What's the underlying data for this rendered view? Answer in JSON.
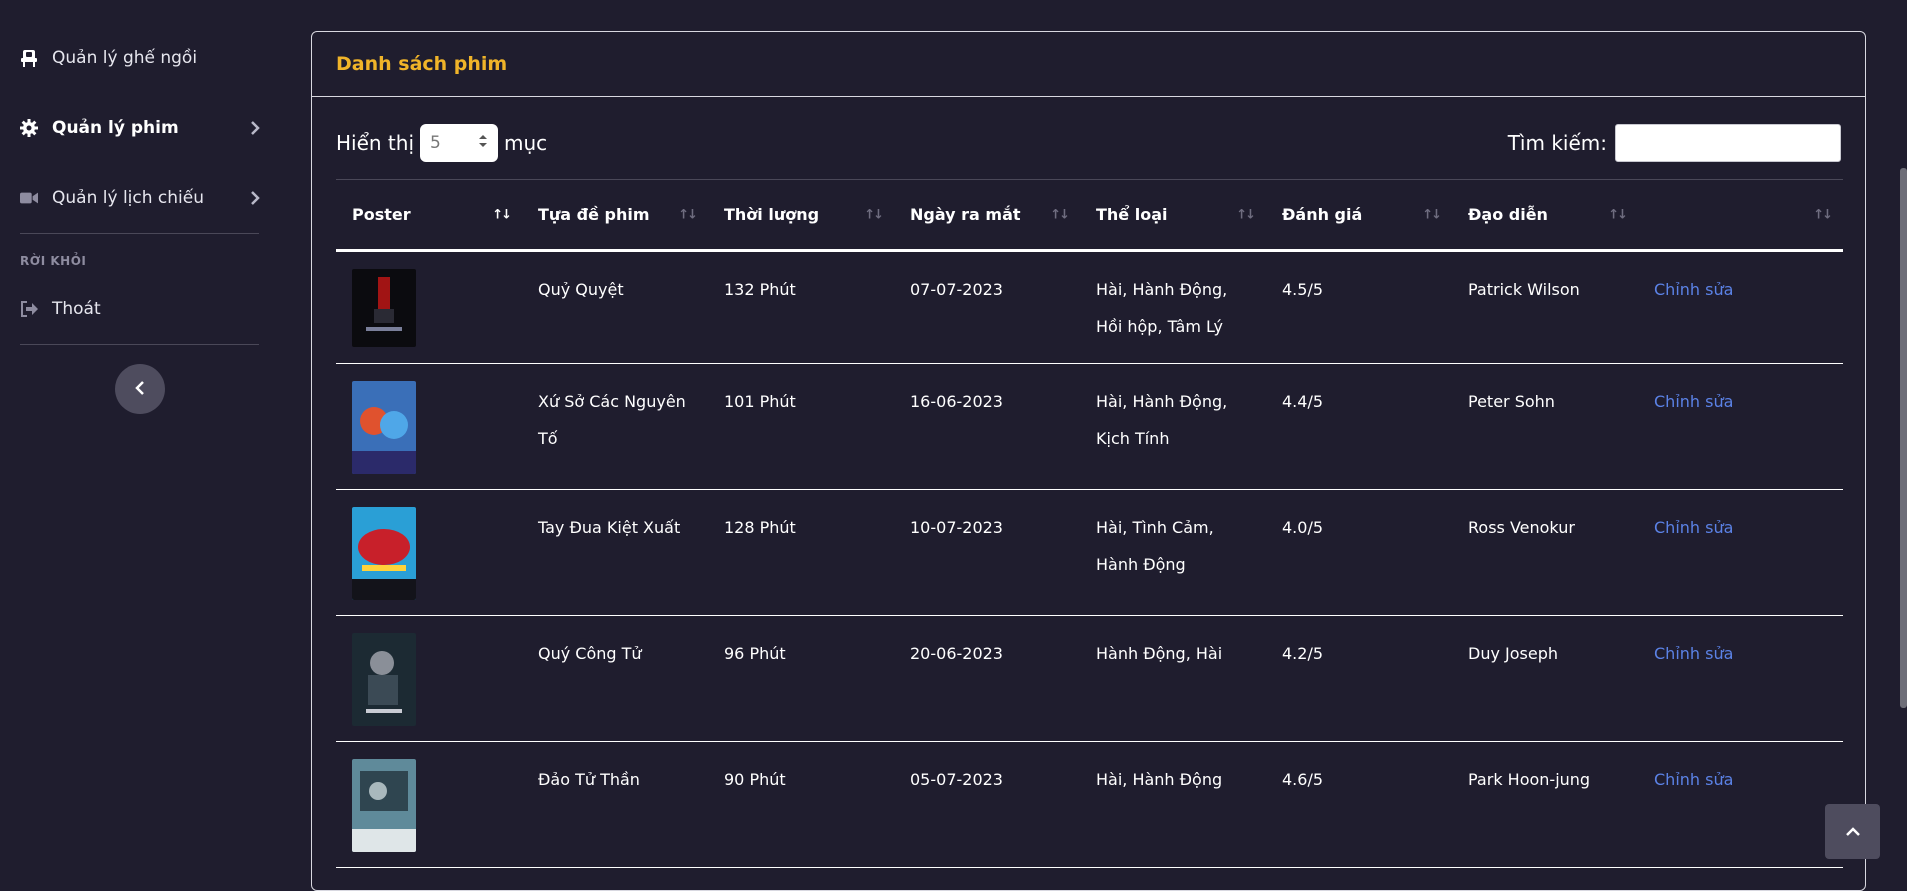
{
  "sidebar": {
    "items": [
      {
        "label": "Quản lý ghế ngồi",
        "icon": "seat-icon"
      },
      {
        "label": "Quản lý phim",
        "icon": "gear-icon",
        "active": true
      },
      {
        "label": "Quản lý lịch chiếu",
        "icon": "video-icon"
      }
    ],
    "section_heading": "RỜI KHỎI",
    "logout_label": "Thoát"
  },
  "card": {
    "title": "Danh sách phim",
    "length_prefix": "Hiển thị",
    "length_value": "5",
    "length_suffix": "mục",
    "search_label": "Tìm kiếm:",
    "search_value": ""
  },
  "table": {
    "columns": [
      "Poster",
      "Tựa đề phim",
      "Thời lượng",
      "Ngày ra mắt",
      "Thể loại",
      "Đánh giá",
      "Đạo diễn",
      ""
    ],
    "rows": [
      {
        "title": "Quỷ Quyệt",
        "duration": "132 Phút",
        "release": "07-07-2023",
        "genre": "Hài, Hành Động, Hồi hộp, Tâm Lý",
        "rating": "4.5/5",
        "director": "Patrick Wilson",
        "action": "Chỉnh sửa"
      },
      {
        "title": "Xứ Sở Các Nguyên Tố",
        "duration": "101 Phút",
        "release": "16-06-2023",
        "genre": "Hài, Hành Động, Kịch Tính",
        "rating": "4.4/5",
        "director": "Peter Sohn",
        "action": "Chỉnh sửa"
      },
      {
        "title": "Tay Đua Kiệt Xuất",
        "duration": "128 Phút",
        "release": "10-07-2023",
        "genre": "Hài, Tình Cảm, Hành Động",
        "rating": "4.0/5",
        "director": "Ross Venokur",
        "action": "Chỉnh sửa"
      },
      {
        "title": "Quý Công Tử",
        "duration": "96 Phút",
        "release": "20-06-2023",
        "genre": "Hành Động, Hài",
        "rating": "4.2/5",
        "director": "Duy Joseph",
        "action": "Chỉnh sửa"
      },
      {
        "title": "Đảo Tử Thần",
        "duration": "90 Phút",
        "release": "05-07-2023",
        "genre": "Hài, Hành Động",
        "rating": "4.6/5",
        "director": "Park Hoon-jung",
        "action": "Chỉnh sửa"
      }
    ]
  },
  "colors": {
    "accent": "#f0b429",
    "link": "#5b82e6",
    "background": "#1f1d2e"
  }
}
